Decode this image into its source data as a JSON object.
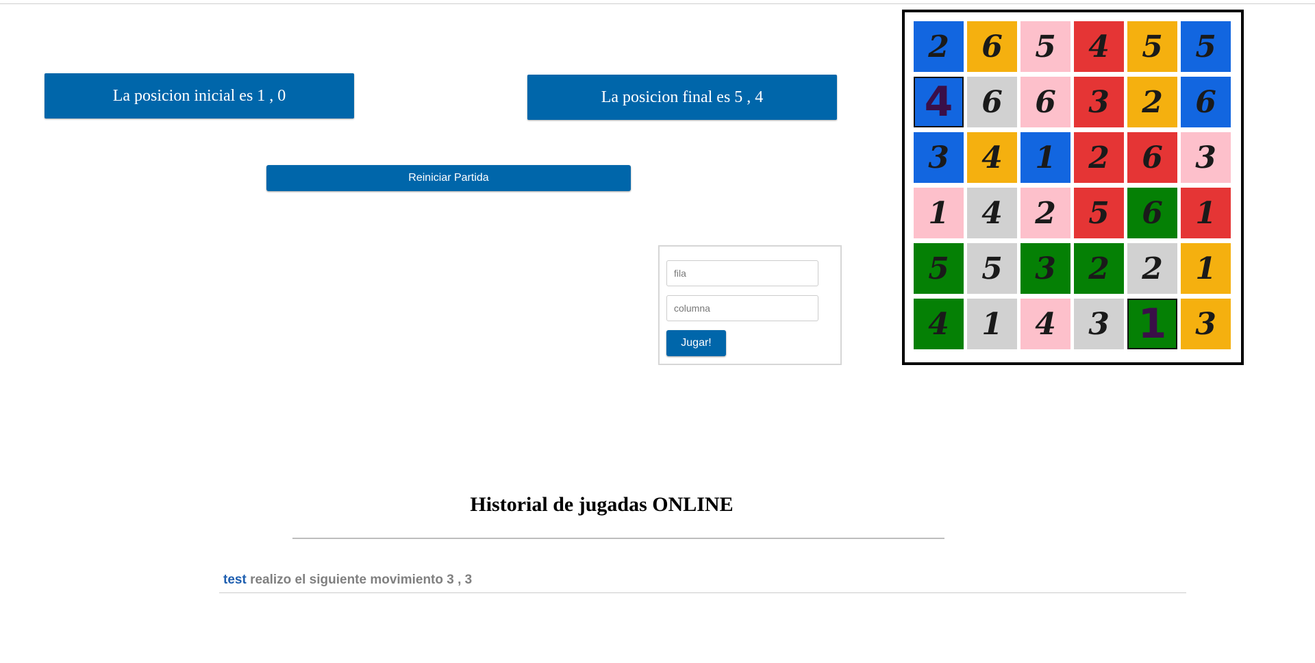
{
  "status": {
    "start_position": "La posicion inicial es 1 , 0",
    "end_position": "La posicion final es 5 , 4"
  },
  "controls": {
    "reset_label": "Reiniciar Partida",
    "row_placeholder": "fila",
    "column_placeholder": "columna",
    "play_label": "Jugar!"
  },
  "colors": {
    "blue": "#1266e0",
    "yellow": "#f5b00f",
    "pink": "#fdc0cb",
    "red": "#e53535",
    "gray": "#d1d1d1",
    "green": "#058005",
    "accent": "#0066aa"
  },
  "board": {
    "cells": [
      [
        {
          "n": "2",
          "c": "blue"
        },
        {
          "n": "6",
          "c": "yellow"
        },
        {
          "n": "5",
          "c": "pink"
        },
        {
          "n": "4",
          "c": "red"
        },
        {
          "n": "5",
          "c": "yellow"
        },
        {
          "n": "5",
          "c": "blue"
        }
      ],
      [
        {
          "n": "4",
          "c": "blue",
          "marked": true
        },
        {
          "n": "6",
          "c": "gray"
        },
        {
          "n": "6",
          "c": "pink"
        },
        {
          "n": "3",
          "c": "red"
        },
        {
          "n": "2",
          "c": "yellow"
        },
        {
          "n": "6",
          "c": "blue"
        }
      ],
      [
        {
          "n": "3",
          "c": "blue"
        },
        {
          "n": "4",
          "c": "yellow"
        },
        {
          "n": "1",
          "c": "blue"
        },
        {
          "n": "2",
          "c": "red"
        },
        {
          "n": "6",
          "c": "red"
        },
        {
          "n": "3",
          "c": "pink"
        }
      ],
      [
        {
          "n": "1",
          "c": "pink"
        },
        {
          "n": "4",
          "c": "gray"
        },
        {
          "n": "2",
          "c": "pink"
        },
        {
          "n": "5",
          "c": "red"
        },
        {
          "n": "6",
          "c": "green"
        },
        {
          "n": "1",
          "c": "red"
        }
      ],
      [
        {
          "n": "5",
          "c": "green"
        },
        {
          "n": "5",
          "c": "gray"
        },
        {
          "n": "3",
          "c": "green"
        },
        {
          "n": "2",
          "c": "green"
        },
        {
          "n": "2",
          "c": "gray"
        },
        {
          "n": "1",
          "c": "yellow"
        }
      ],
      [
        {
          "n": "4",
          "c": "green"
        },
        {
          "n": "1",
          "c": "gray"
        },
        {
          "n": "4",
          "c": "pink"
        },
        {
          "n": "3",
          "c": "gray"
        },
        {
          "n": "1",
          "c": "green",
          "marked": true
        },
        {
          "n": "3",
          "c": "yellow"
        }
      ]
    ]
  },
  "history": {
    "title": "Historial de jugadas ONLINE",
    "entries": [
      {
        "user": "test",
        "text": " realizo el siguiente movimiento 3 , 3"
      }
    ]
  }
}
